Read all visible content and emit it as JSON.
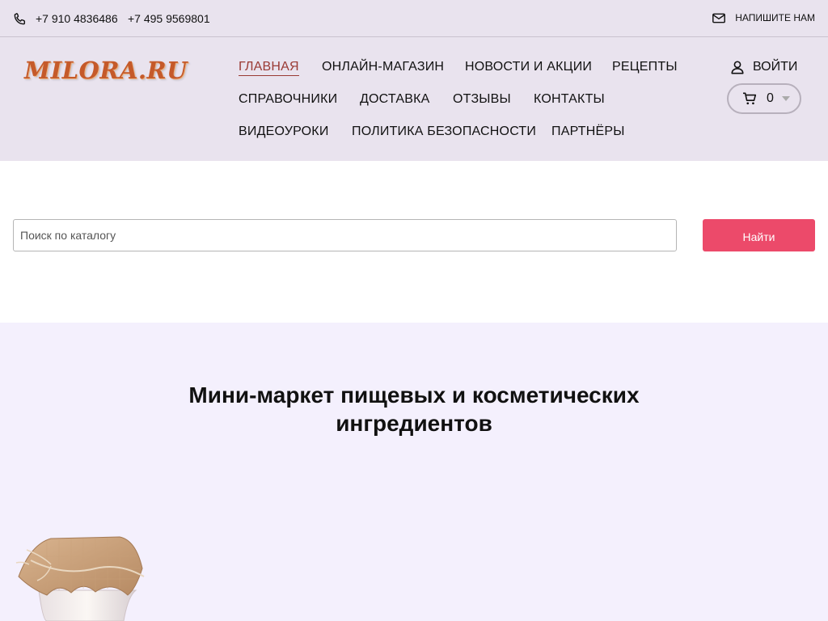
{
  "topbar": {
    "phone1": "+7 910 4836486",
    "phone2": "+7 495 9569801",
    "contact_label": "НАПИШИТЕ НАМ"
  },
  "header": {
    "logo": "MILORA.RU",
    "nav": [
      "ГЛАВНАЯ",
      "ОНЛАЙН-МАГАЗИН",
      "НОВОСТИ И АКЦИИ",
      "РЕЦЕПТЫ",
      "СПРАВОЧНИКИ",
      "ДОСТАВКА",
      "ОТЗЫВЫ",
      "КОНТАКТЫ",
      "ВИДЕОУРОКИ",
      "ПОЛИТИКА БЕЗОПАСНОСТИ",
      "ПАРТНЁРЫ"
    ],
    "active_nav": "ГЛАВНАЯ",
    "login_label": "ВОЙТИ",
    "cart_count": "0"
  },
  "search": {
    "placeholder": "Поиск по каталогу",
    "button_label": "Найти"
  },
  "hero": {
    "title_line1": "Мини-маркет пищевых и косметических",
    "title_line2": "ингредиентов"
  },
  "colors": {
    "header_bg": "#e9e3ee",
    "accent": "#ec4a6a",
    "active_link": "#9a3a34",
    "hero_bg": "#f4f0fd"
  },
  "icons": [
    "phone-icon",
    "mail-icon",
    "user-icon",
    "cart-icon",
    "chevron-down-icon"
  ]
}
